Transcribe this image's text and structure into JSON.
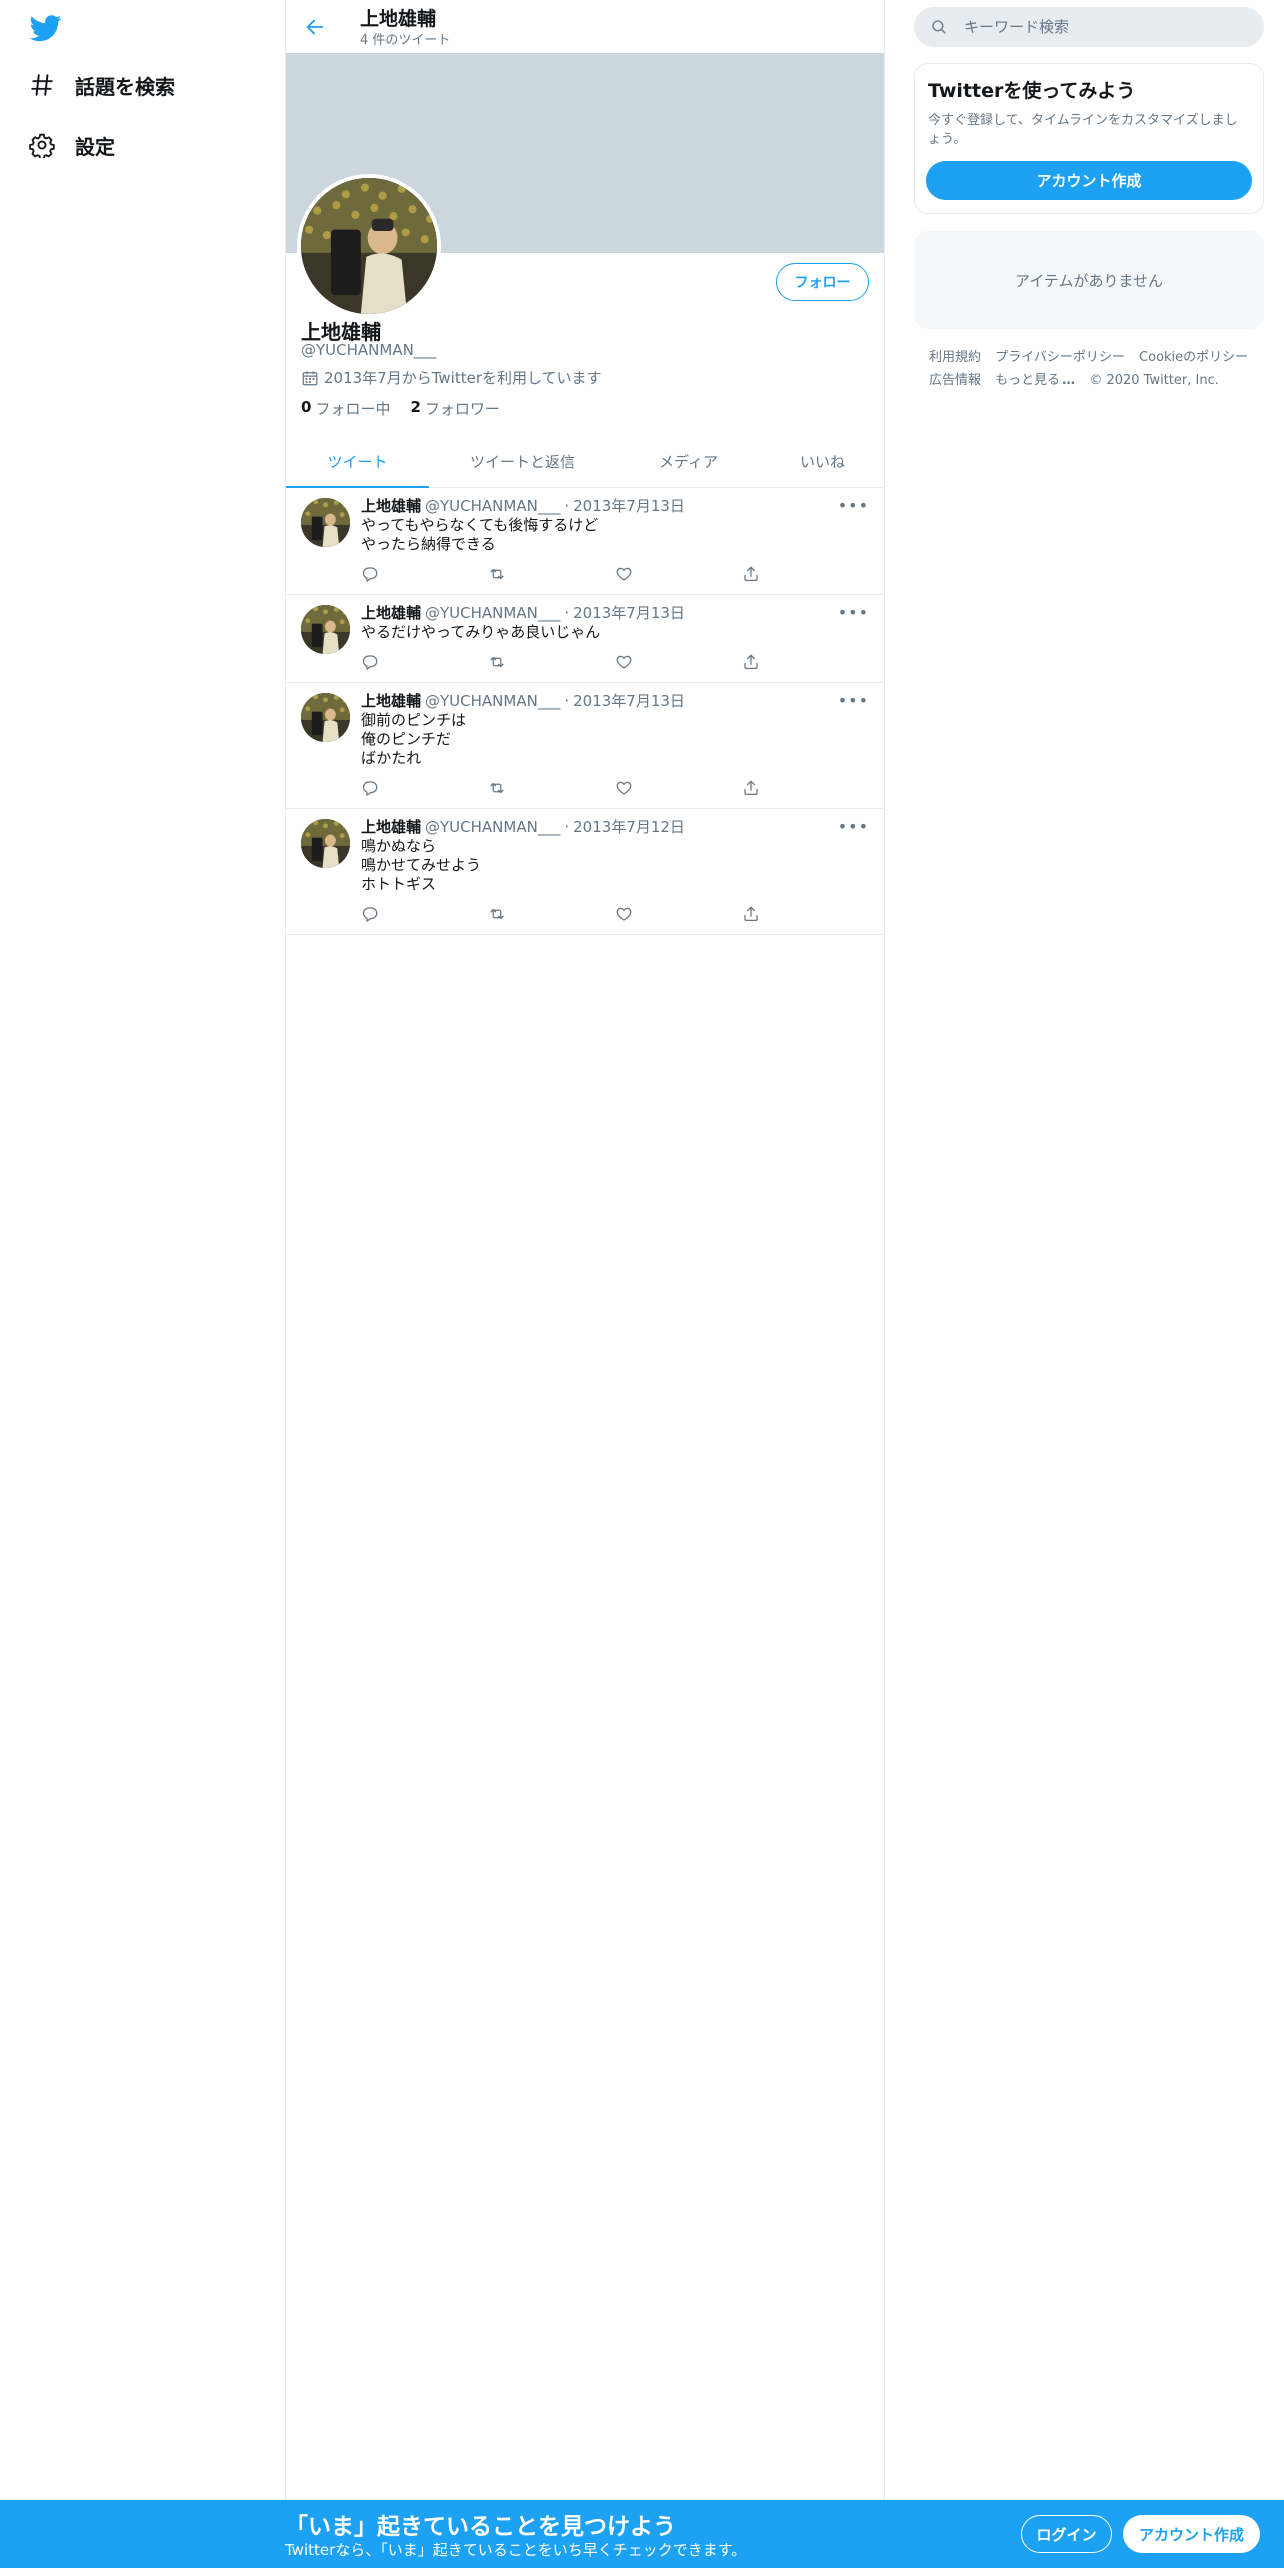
{
  "colors": {
    "accent": "#1da1f2",
    "text": "#14171a",
    "secondary_text": "#657786",
    "border": "#e6ecf0",
    "banner": "#ccd6dd"
  },
  "nav": {
    "logo_icon": "twitter-bird-icon",
    "items": [
      {
        "label": "話題を検索",
        "icon": "hashtag-icon"
      },
      {
        "label": "設定",
        "icon": "gear-icon"
      }
    ]
  },
  "topbar": {
    "name": "上地雄輔",
    "tweet_count": "4 件のツイート"
  },
  "profile": {
    "name": "上地雄輔",
    "handle": "@YUCHANMAN___",
    "joined": "2013年7月からTwitterを利用しています",
    "following_count": "0",
    "following_label": "フォロー中",
    "followers_count": "2",
    "followers_label": "フォロワー",
    "follow_button": "フォロー"
  },
  "tabs": [
    {
      "label": "ツイート",
      "active": true
    },
    {
      "label": "ツイートと返信",
      "active": false
    },
    {
      "label": "メディア",
      "active": false
    },
    {
      "label": "いいね",
      "active": false
    }
  ],
  "tweets": [
    {
      "name": "上地雄輔",
      "handle": "@YUCHANMAN___",
      "date": "2013年7月13日",
      "text": "やってもやらなくても後悔するけど\nやったら納得できる"
    },
    {
      "name": "上地雄輔",
      "handle": "@YUCHANMAN___",
      "date": "2013年7月13日",
      "text": "やるだけやってみりゃあ良いじゃん"
    },
    {
      "name": "上地雄輔",
      "handle": "@YUCHANMAN___",
      "date": "2013年7月13日",
      "text": "御前のピンチは\n 俺のピンチだ\nばかたれ"
    },
    {
      "name": "上地雄輔",
      "handle": "@YUCHANMAN___",
      "date": "2013年7月12日",
      "text": "鳴かぬなら\n 鳴かせてみせよう\nホトトギス"
    }
  ],
  "sidebar": {
    "search_placeholder": "キーワード検索",
    "signup_title": "Twitterを使ってみよう",
    "signup_desc": "今すぐ登録して、タイムラインをカスタマイズしましょう。",
    "signup_button": "アカウント作成",
    "empty_message": "アイテムがありません",
    "footer": {
      "terms": "利用規約",
      "privacy": "プライバシーポリシー",
      "cookie": "Cookieのポリシー",
      "ads": "広告情報",
      "more": "もっと見る",
      "copyright": "© 2020 Twitter, Inc."
    }
  },
  "bottom_bar": {
    "title": "「いま」起きていることを見つけよう",
    "subtitle": "Twitterなら、「いま」起きていることをいち早くチェックできます。",
    "login": "ログイン",
    "signup": "アカウント作成"
  }
}
